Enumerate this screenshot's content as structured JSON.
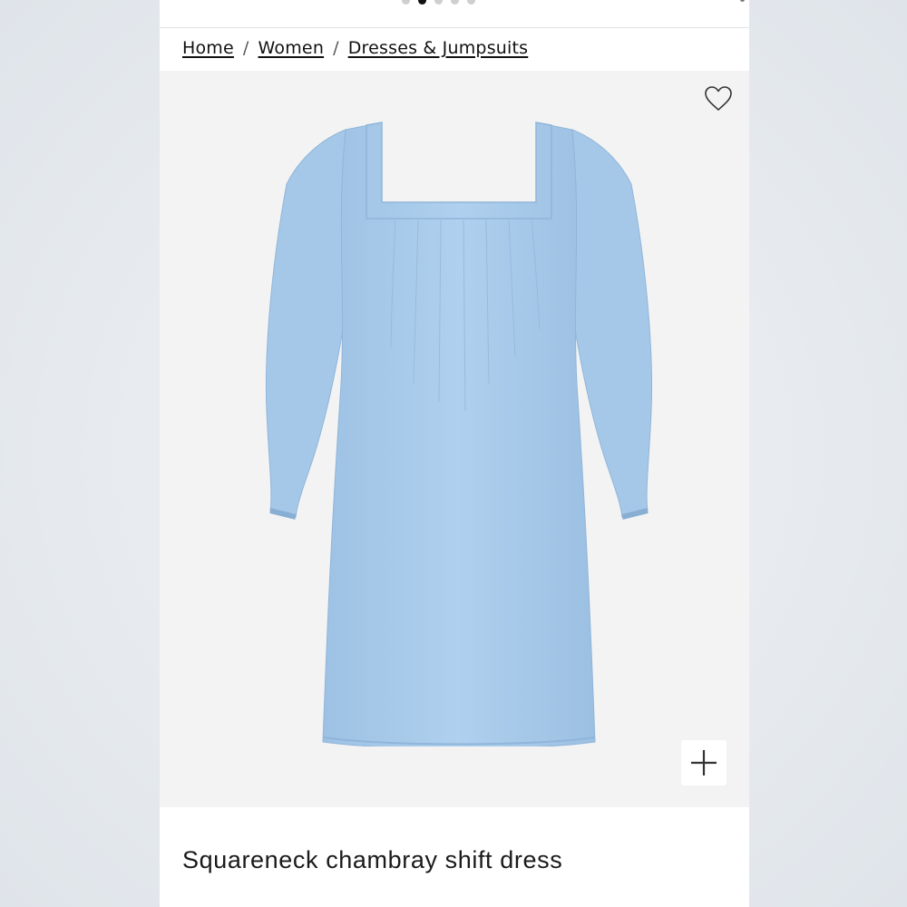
{
  "pager": {
    "total": 5,
    "active_index": 1
  },
  "breadcrumb": {
    "items": [
      "Home",
      "Women",
      "Dresses & Jumpsuits"
    ],
    "separator": "/"
  },
  "product": {
    "title": "Squareneck chambray shift dress",
    "image_icon": "dress-photo",
    "dress_color": "#a9cbea"
  },
  "actions": {
    "wishlist_icon": "heart-icon",
    "zoom_icon": "plus-icon"
  },
  "colors": {
    "page_bg": "#e7ebef",
    "panel_bg": "#f3f3f3",
    "text": "#111111"
  }
}
